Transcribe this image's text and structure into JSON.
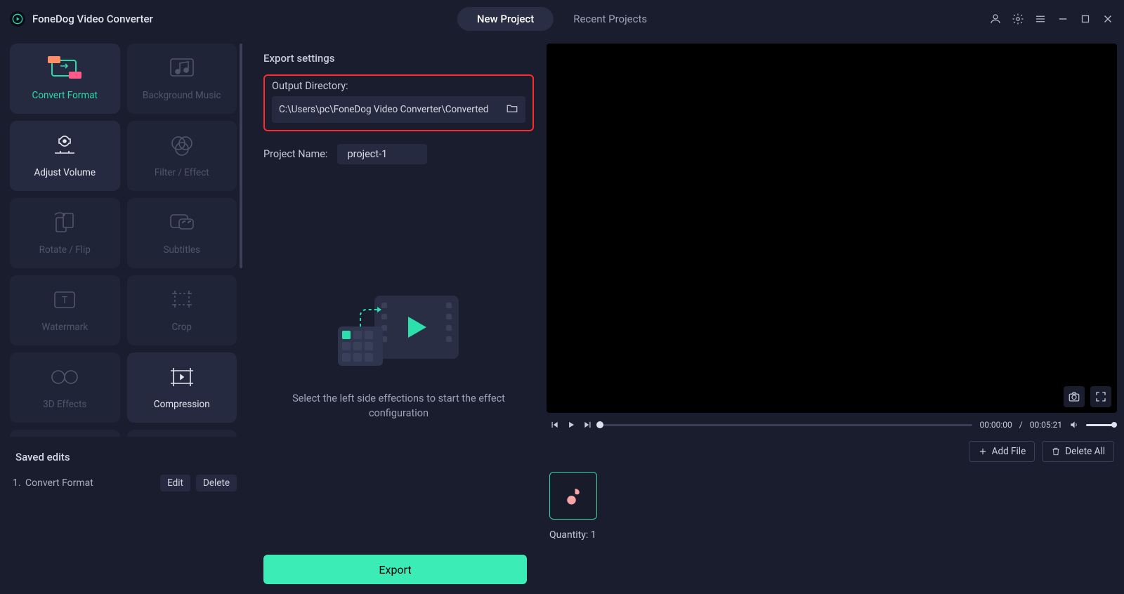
{
  "app_title": "FoneDog Video Converter",
  "tabs": {
    "new_project": "New Project",
    "recent_projects": "Recent Projects"
  },
  "tools": [
    {
      "label": "Convert Format"
    },
    {
      "label": "Background Music"
    },
    {
      "label": "Adjust Volume"
    },
    {
      "label": "Filter / Effect"
    },
    {
      "label": "Rotate / Flip"
    },
    {
      "label": "Subtitles"
    },
    {
      "label": "Watermark"
    },
    {
      "label": "Crop"
    },
    {
      "label": "3D Effects"
    },
    {
      "label": "Compression"
    }
  ],
  "saved": {
    "title": "Saved edits",
    "items": [
      {
        "num": "1.",
        "name": "Convert Format"
      }
    ],
    "edit": "Edit",
    "delete": "Delete"
  },
  "export": {
    "heading": "Export settings",
    "output_dir_label": "Output Directory:",
    "output_dir_value": "C:\\Users\\pc\\FoneDog Video Converter\\Converted",
    "project_name_label": "Project Name:",
    "project_name_value": "project-1",
    "placeholder_text": "Select the left side effections to start the effect configuration",
    "button": "Export"
  },
  "player": {
    "current": "00:00:00",
    "duration": "00:05:21",
    "sep": " / "
  },
  "file_actions": {
    "add": "Add File",
    "delete_all": "Delete All"
  },
  "quantity": {
    "label": "Quantity: ",
    "value": "1"
  }
}
